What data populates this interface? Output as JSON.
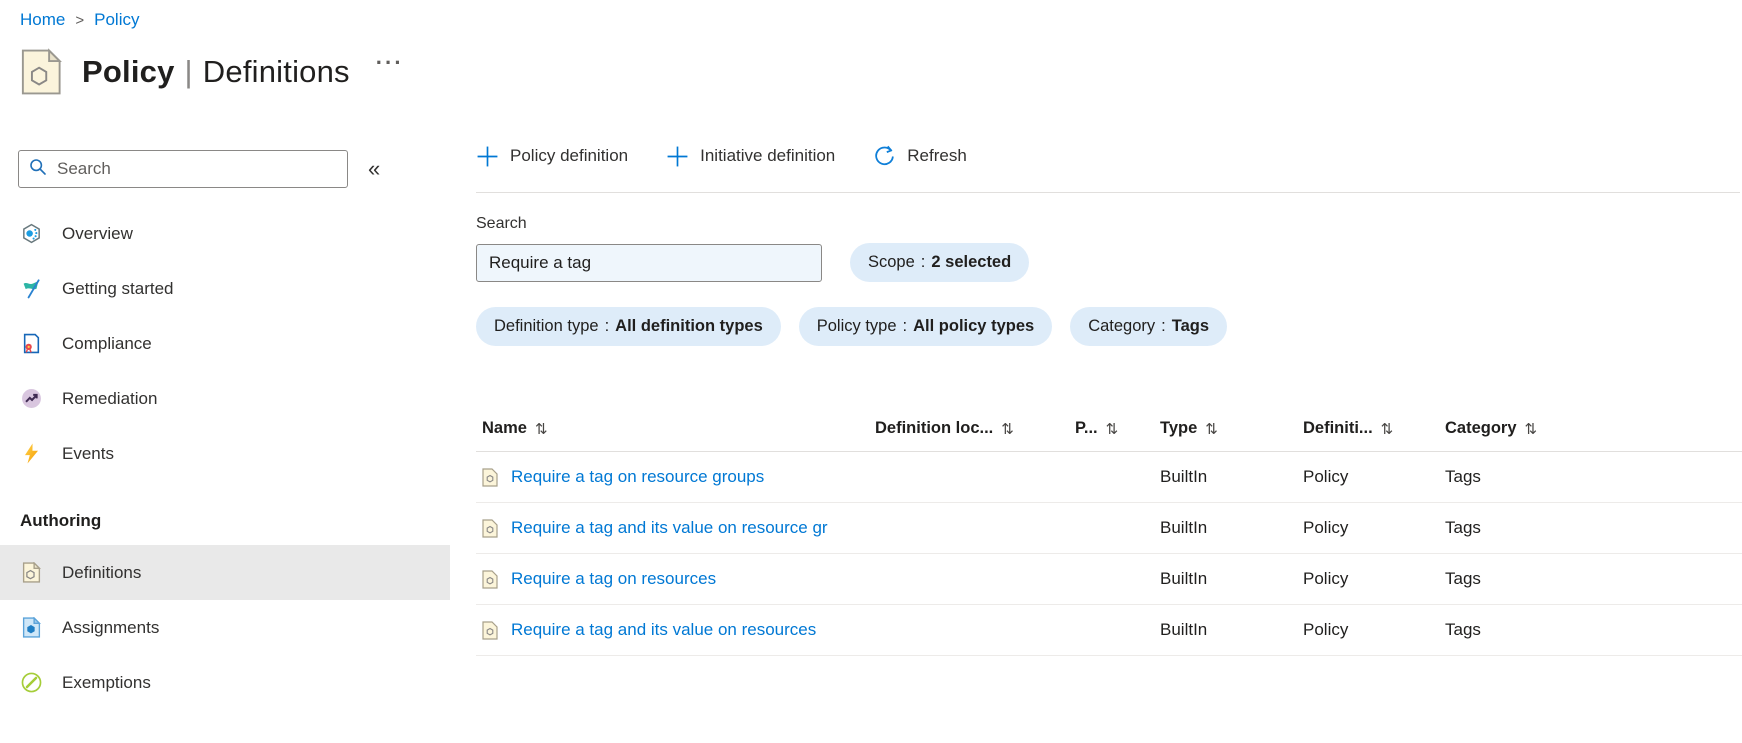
{
  "breadcrumb": {
    "separator": ">",
    "items": [
      {
        "label": "Home"
      },
      {
        "label": "Policy"
      }
    ]
  },
  "header": {
    "title_primary": "Policy",
    "title_separator": "|",
    "title_secondary": "Definitions",
    "more_label": "···"
  },
  "sidebar": {
    "search_placeholder": "Search",
    "collapse_icon": "«",
    "items": [
      {
        "label": "Overview",
        "icon": "overview-icon"
      },
      {
        "label": "Getting started",
        "icon": "getting-started-icon"
      },
      {
        "label": "Compliance",
        "icon": "compliance-icon"
      },
      {
        "label": "Remediation",
        "icon": "remediation-icon"
      },
      {
        "label": "Events",
        "icon": "events-icon"
      }
    ],
    "section_header": "Authoring",
    "authoring_items": [
      {
        "label": "Definitions",
        "icon": "definitions-icon",
        "selected": true
      },
      {
        "label": "Assignments",
        "icon": "assignments-icon",
        "selected": false
      },
      {
        "label": "Exemptions",
        "icon": "exemptions-icon",
        "selected": false
      }
    ]
  },
  "toolbar": {
    "policy_definition_label": "Policy definition",
    "initiative_definition_label": "Initiative definition",
    "refresh_label": "Refresh"
  },
  "filters": {
    "search_label": "Search",
    "search_value": "Require a tag",
    "pill_separator": ":",
    "pills": [
      {
        "label": "Scope",
        "value": "2 selected"
      },
      {
        "label": "Definition type",
        "value": "All definition types"
      },
      {
        "label": "Policy type",
        "value": "All policy types"
      },
      {
        "label": "Category",
        "value": "Tags"
      }
    ]
  },
  "table": {
    "sort_icon": "⇅",
    "columns": [
      "Name",
      "Definition loc...",
      "P...",
      "Type",
      "Definiti...",
      "Category"
    ],
    "rows": [
      {
        "name": "Require a tag on resource groups",
        "definition_location": "",
        "p": "",
        "type": "BuiltIn",
        "definition_type": "Policy",
        "category": "Tags"
      },
      {
        "name": "Require a tag and its value on resource gr",
        "definition_location": "",
        "p": "",
        "type": "BuiltIn",
        "definition_type": "Policy",
        "category": "Tags"
      },
      {
        "name": "Require a tag on resources",
        "definition_location": "",
        "p": "",
        "type": "BuiltIn",
        "definition_type": "Policy",
        "category": "Tags"
      },
      {
        "name": "Require a tag and its value on resources",
        "definition_location": "",
        "p": "",
        "type": "BuiltIn",
        "definition_type": "Policy",
        "category": "Tags"
      }
    ]
  },
  "colors": {
    "accent": "#0078d4",
    "link": "#0078d4",
    "pill_background": "#deecf9",
    "selected_item_background": "#e9e9e9",
    "search_input_background": "#eff6fc"
  }
}
